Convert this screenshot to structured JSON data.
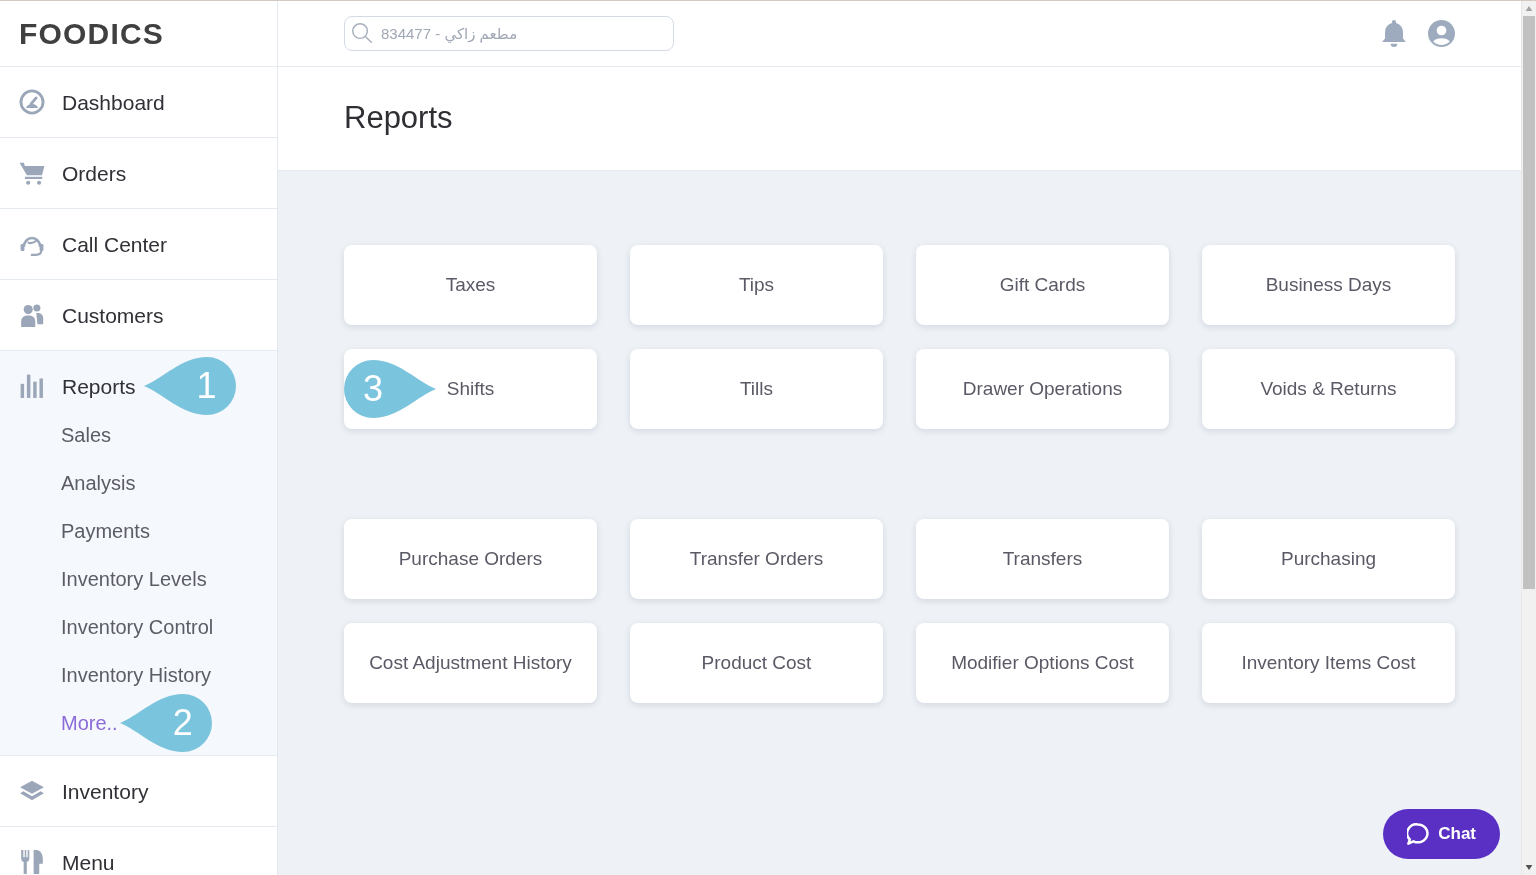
{
  "logo": {
    "text": "FOODICS"
  },
  "sidebar": {
    "items": [
      {
        "label": "Dashboard",
        "expanded": false
      },
      {
        "label": "Orders",
        "expanded": false
      },
      {
        "label": "Call Center",
        "expanded": false
      },
      {
        "label": "Customers",
        "expanded": false
      },
      {
        "label": "Reports",
        "expanded": true,
        "callout": {
          "number": "1"
        },
        "children": [
          {
            "label": "Sales",
            "kind": "page"
          },
          {
            "label": "Analysis",
            "kind": "page"
          },
          {
            "label": "Payments",
            "kind": "page"
          },
          {
            "label": "Inventory Levels",
            "kind": "page"
          },
          {
            "label": "Inventory Control",
            "kind": "page"
          },
          {
            "label": "Inventory History",
            "kind": "page"
          },
          {
            "label": "More..",
            "kind": "more",
            "callout": {
              "number": "2"
            }
          }
        ]
      },
      {
        "label": "Inventory",
        "expanded": false
      },
      {
        "label": "Menu",
        "expanded": false
      }
    ]
  },
  "header": {
    "search": {
      "placeholder": "834477 - مطعم زاكي"
    }
  },
  "page_title": "Reports",
  "report_groups": [
    {
      "cards": [
        {
          "label": "Taxes"
        },
        {
          "label": "Tips"
        },
        {
          "label": "Gift Cards"
        },
        {
          "label": "Business Days"
        },
        {
          "label": "Shifts",
          "callout": {
            "number": "3"
          }
        },
        {
          "label": "Tills"
        },
        {
          "label": "Drawer Operations"
        },
        {
          "label": "Voids & Returns"
        }
      ]
    },
    {
      "cards": [
        {
          "label": "Purchase Orders"
        },
        {
          "label": "Transfer Orders"
        },
        {
          "label": "Transfers"
        },
        {
          "label": "Purchasing"
        },
        {
          "label": "Cost Adjustment History"
        },
        {
          "label": "Product Cost"
        },
        {
          "label": "Modifier Options Cost"
        },
        {
          "label": "Inventory Items Cost"
        }
      ]
    }
  ],
  "chat_button": {
    "label": "Chat"
  }
}
